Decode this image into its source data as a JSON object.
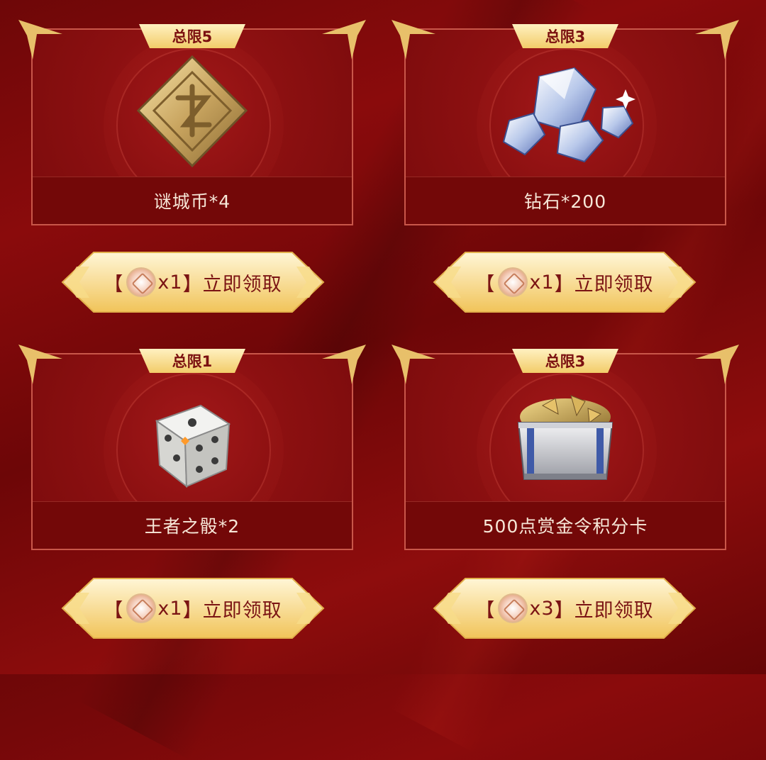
{
  "colors": {
    "background": "#7b0a0b",
    "card_border": "#c9574a",
    "gold": "#f3cf72",
    "button_text": "#7b1414",
    "name_text": "#f7e7d8"
  },
  "cards": [
    {
      "limit": "总限5",
      "name": "谜城币*4",
      "icon": "mystery-city-coin-icon",
      "button": {
        "bracket_open": "【",
        "cost": "x1",
        "bracket_close": "】",
        "action": "立即领取",
        "currency_icon": "token-coin-icon"
      }
    },
    {
      "limit": "总限3",
      "name": "钻石*200",
      "icon": "diamond-pile-icon",
      "button": {
        "bracket_open": "【",
        "cost": "x1",
        "bracket_close": "】",
        "action": "立即领取",
        "currency_icon": "token-coin-icon"
      }
    },
    {
      "limit": "总限1",
      "name": "王者之骰*2",
      "icon": "dice-icon",
      "button": {
        "bracket_open": "【",
        "cost": "x1",
        "bracket_close": "】",
        "action": "立即领取",
        "currency_icon": "token-coin-icon"
      }
    },
    {
      "limit": "总限3",
      "name": "500点赏金令积分卡",
      "icon": "treasure-crate-icon",
      "button": {
        "bracket_open": "【",
        "cost": "x3",
        "bracket_close": "】",
        "action": "立即领取",
        "currency_icon": "token-coin-icon"
      }
    }
  ]
}
